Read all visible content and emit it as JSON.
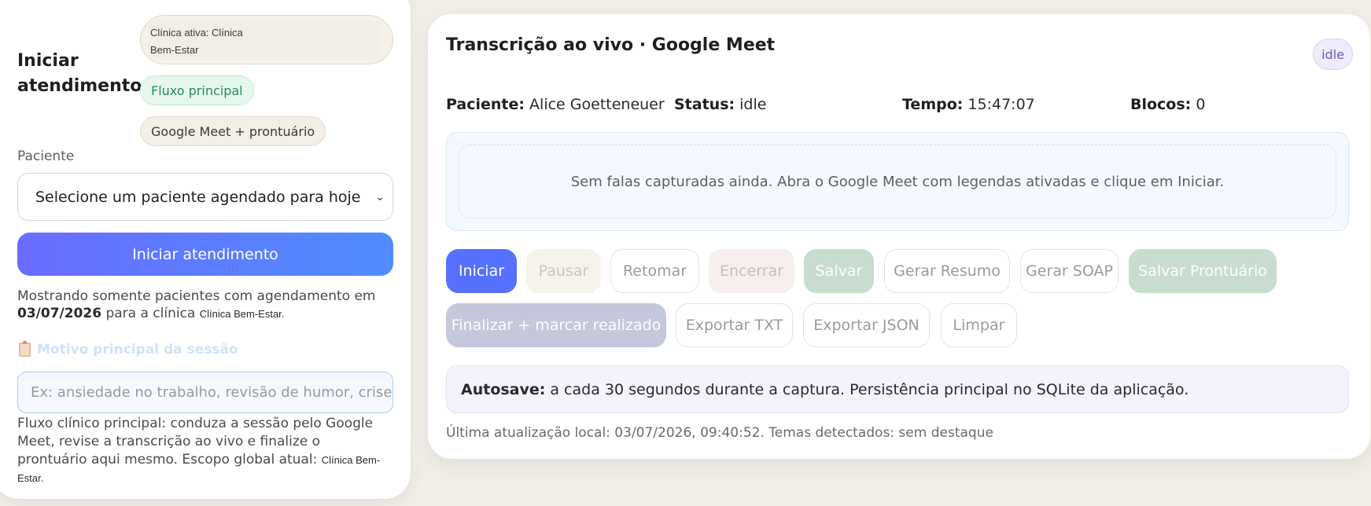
{
  "left": {
    "title": "Iniciar atendimento",
    "clinic_pill": {
      "prefix": "Clínica ativa: Clínica",
      "suffix": "Bem-Estar"
    },
    "flow_pill": "Fluxo principal",
    "meet_pill": "Google Meet + prontuário",
    "patient_label": "Paciente",
    "patient_select_value": "Selecione um paciente agendado para hoje",
    "start_button": "Iniciar atendimento",
    "hint": {
      "prefix": "Mostrando somente pacientes com agendamento em",
      "date": "03/07/2026",
      "middle": "para a clínica",
      "clinic": "Clínica Bem-Estar."
    },
    "motivo_label": "Motivo principal da sessão",
    "motivo_placeholder": "Ex: ansiedade no trabalho, revisão de humor, crise de",
    "footer": {
      "text": "Fluxo clínico principal: conduza a sessão pelo Google Meet, revise a transcrição ao vivo e finalize o prontuário aqui mesmo. Escopo global atual:",
      "clinic": "Clínica Bem-Estar."
    }
  },
  "right": {
    "title": "Transcrição ao vivo · Google Meet",
    "badge": "idle",
    "stats": [
      {
        "label": "Paciente:",
        "value": "Alice Goetteneuer"
      },
      {
        "label": "Status:",
        "value": "idle"
      },
      {
        "label": "Tempo:",
        "value": "15:47:07"
      },
      {
        "label": "Blocos:",
        "value": "0"
      }
    ],
    "transcript_empty": "Sem falas capturadas ainda. Abra o Google Meet com legendas ativadas e clique em Iniciar.",
    "buttons_row1": [
      "Iniciar",
      "Pausar",
      "Retomar",
      "Encerrar",
      "Salvar",
      "Gerar Resumo",
      "Gerar SOAP",
      "Salvar Prontuário"
    ],
    "buttons_row2": [
      "Finalizar + marcar realizado",
      "Exportar TXT",
      "Exportar JSON",
      "Limpar"
    ],
    "autosave": {
      "label": "Autosave:",
      "text": "a cada 30 segundos durante a captura. Persistência principal no SQLite da aplicação."
    },
    "last_update": "Última atualização local: 03/07/2026, 09:40:52. Temas detectados: sem destaque"
  }
}
